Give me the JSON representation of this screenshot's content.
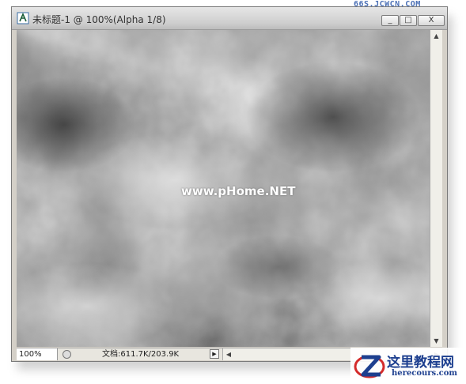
{
  "window": {
    "title": "未标题-1 @ 100%(Alpha 1/8)",
    "buttons": {
      "minimize": "_",
      "maximize": "□",
      "close": "X"
    },
    "icon": "photoshop-doc-icon"
  },
  "watermarks": {
    "top": "66S.JCWCN.COM",
    "center": "www.pHome.NET",
    "logo_cn": "这里教程网",
    "logo_en": "herecours.com"
  },
  "status": {
    "zoom": "100%",
    "doc_info": "文档:611.7K/203.9K",
    "menu_arrow": "▶"
  },
  "scrollbar": {
    "up": "▲",
    "down": "▼",
    "left": "◀",
    "right": "▶"
  },
  "colors": {
    "logo_blue": "#1d3f8f",
    "logo_red": "#d42b2b"
  }
}
